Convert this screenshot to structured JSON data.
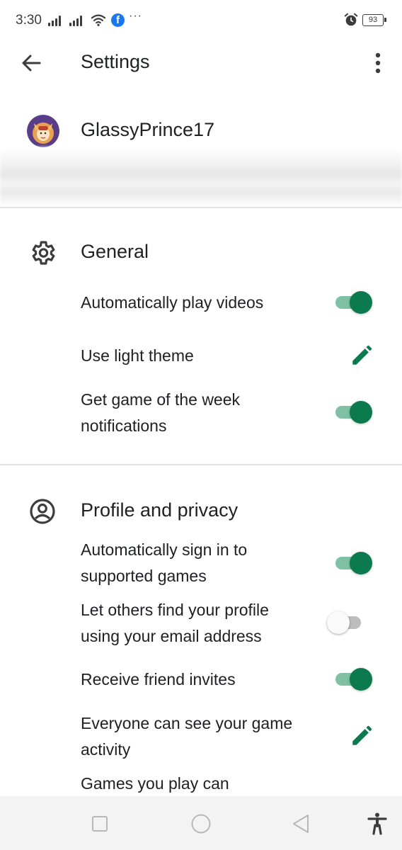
{
  "status_bar": {
    "time": "3:30",
    "battery": "93",
    "overflow": "···"
  },
  "app_bar": {
    "title": "Settings",
    "back_icon": "arrow-back-icon",
    "more_icon": "more-vert-icon"
  },
  "account": {
    "name": "GlassyPrince17"
  },
  "colors": {
    "accent": "#0b7a4f",
    "toggle_track_on": "#7fc1a4",
    "facebook": "#1877f2"
  },
  "general": {
    "title": "General",
    "icon": "gear-icon",
    "rows": [
      {
        "label": "Automatically play videos",
        "control": "toggle",
        "state": "on"
      },
      {
        "label": "Use light theme",
        "control": "edit",
        "icon": "pencil-icon"
      },
      {
        "label": "Get game of the week notifications",
        "control": "toggle",
        "state": "on"
      }
    ]
  },
  "profile_privacy": {
    "title": "Profile and privacy",
    "icon": "account-circle-icon",
    "rows": [
      {
        "label": "Automatically sign in to supported games",
        "control": "toggle",
        "state": "on"
      },
      {
        "label": "Let others find your profile using your email address",
        "control": "toggle",
        "state": "off"
      },
      {
        "label": "Receive friend invites",
        "control": "toggle",
        "state": "on"
      },
      {
        "label": "Everyone can see your game activity",
        "control": "edit",
        "icon": "pencil-icon"
      },
      {
        "label": "Games you play can"
      }
    ]
  },
  "nav_bar": {
    "items": [
      "recent-apps-icon",
      "home-icon",
      "back-triangle-icon",
      "accessibility-icon"
    ]
  }
}
